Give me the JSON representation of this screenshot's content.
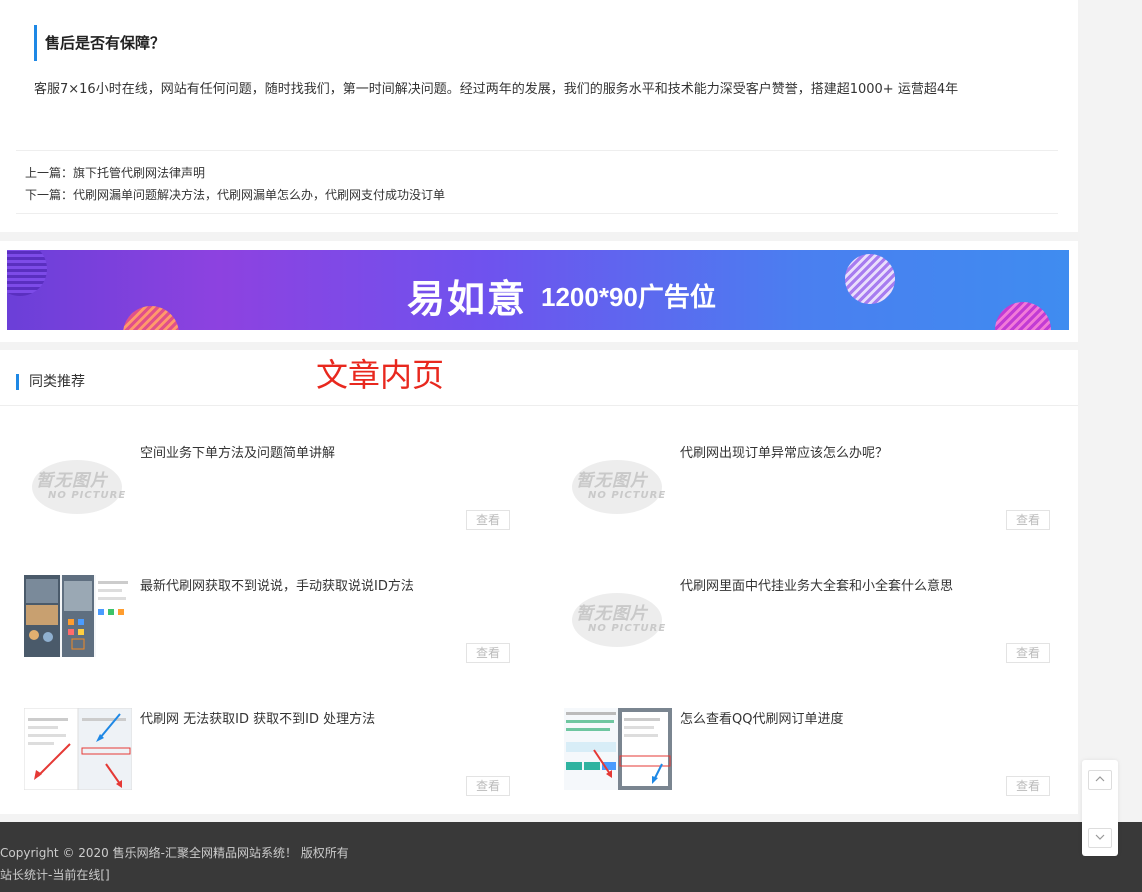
{
  "article": {
    "faq_title": "售后是否有保障？",
    "faq_answer": "客服7×16小时在线，网站有任何问题，随时找我们，第一时间解决问题。经过两年的发展，我们的服务水平和技术能力深受客户赞誉，搭建超1000+ 运营超4年"
  },
  "navigation": {
    "prev_label": "上一篇：",
    "prev_title": "旗下托管代刷网法律声明",
    "next_label": "下一篇：",
    "next_title": "代刷网漏单问题解决方法，代刷网漏单怎么办，代刷网支付成功没订单"
  },
  "ad": {
    "brand": "易如意",
    "size_text": "1200*90广告位"
  },
  "overlay_label": "文章内页",
  "recommend": {
    "title": "同类推荐",
    "view_label": "查看",
    "nopic_cn": "暂无图片",
    "nopic_en": "NO PICTURE",
    "items": [
      {
        "title": "空间业务下单方法及问题简单讲解",
        "thumb": "no-picture"
      },
      {
        "title": "代刷网出现订单异常应该怎么办呢？",
        "thumb": "no-picture"
      },
      {
        "title": "最新代刷网获取不到说说，手动获取说说ID方法",
        "thumb": "phone-screenshot"
      },
      {
        "title": "代刷网里面中代挂业务大全套和小全套什么意思",
        "thumb": "no-picture"
      },
      {
        "title": "代刷网 无法获取ID 获取不到ID 处理方法",
        "thumb": "app-screenshot-arrows"
      },
      {
        "title": "怎么查看QQ代刷网订单进度",
        "thumb": "order-screenshot-arrows"
      }
    ]
  },
  "footer": {
    "copyright": "Copyright © 2020 售乐网络-汇聚全网精品网站系统！ 版权所有",
    "stats": "站长统计-当前在线[]"
  },
  "tools": {
    "up_icon": "chevron-up-icon",
    "down_icon": "chevron-down-icon"
  },
  "colors": {
    "accent": "#1e88e5",
    "overlay_label": "#e8281e",
    "footer_bg": "#393939"
  }
}
